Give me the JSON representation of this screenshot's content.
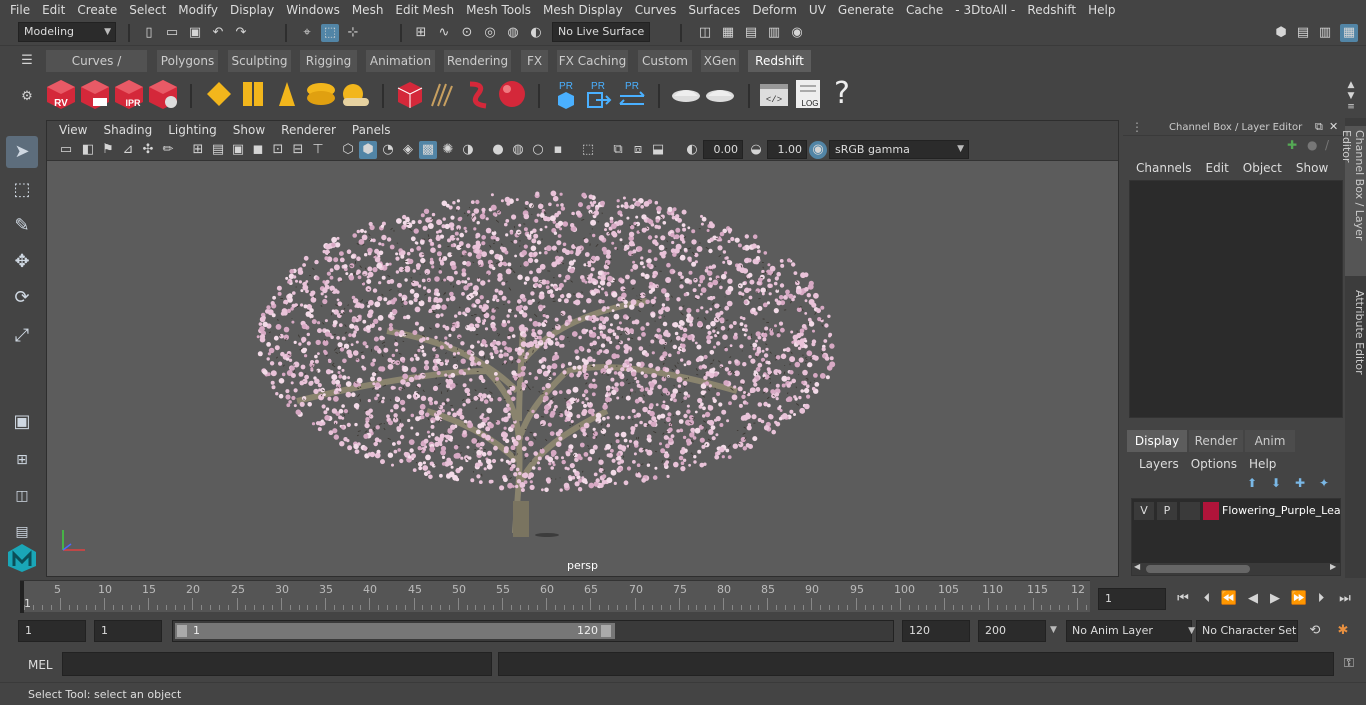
{
  "menubar": {
    "items": [
      "File",
      "Edit",
      "Create",
      "Select",
      "Modify",
      "Display",
      "Windows",
      "Mesh",
      "Edit Mesh",
      "Mesh Tools",
      "Mesh Display",
      "Curves",
      "Surfaces",
      "Deform",
      "UV",
      "Generate",
      "Cache",
      "- 3DtoAll -",
      "Redshift",
      "Help"
    ]
  },
  "status": {
    "mode_select": "Modeling",
    "live_surface": "No Live Surface"
  },
  "shelf": {
    "tabs": [
      "Curves / Surfaces",
      "Polygons",
      "Sculpting",
      "Rigging",
      "Animation",
      "Rendering",
      "FX",
      "FX Caching",
      "Custom",
      "XGen",
      "Redshift"
    ],
    "selected_tab": "Redshift",
    "buttons": [
      {
        "name": "rv",
        "label": "RV"
      },
      {
        "name": "render-clapper",
        "label": ""
      },
      {
        "name": "ipr",
        "label": "IPR"
      },
      {
        "name": "render-settings",
        "label": ""
      }
    ],
    "pr_labels": [
      "PR",
      "PR",
      "PR"
    ],
    "log_label": "LOG",
    "help_label": "?"
  },
  "viewport": {
    "menus": [
      "View",
      "Shading",
      "Lighting",
      "Show",
      "Renderer",
      "Panels"
    ],
    "exposure": "0.00",
    "gamma": "1.00",
    "color_space": "sRGB gamma",
    "panel_label": "persp"
  },
  "channel_box": {
    "title": "Channel Box / Layer Editor",
    "menus": [
      "Channels",
      "Edit",
      "Object",
      "Show"
    ]
  },
  "layer_editor": {
    "tabs": [
      "Display",
      "Render",
      "Anim"
    ],
    "selected_tab": "Display",
    "menus": [
      "Layers",
      "Options",
      "Help"
    ],
    "layers": [
      {
        "v": "V",
        "p": "P",
        "color": "#b0143a",
        "name": "Flowering_Purple_Leaf"
      }
    ]
  },
  "side_tabs": [
    "Channel Box / Layer Editor",
    "Attribute Editor"
  ],
  "timeline": {
    "ticks": [
      "5",
      "10",
      "15",
      "20",
      "25",
      "30",
      "35",
      "40",
      "45",
      "50",
      "55",
      "60",
      "65",
      "70",
      "75",
      "80",
      "85",
      "90",
      "95",
      "100",
      "105",
      "110",
      "115",
      "12"
    ],
    "start_marker": "1",
    "current_frame": "1"
  },
  "range": {
    "start": "1",
    "playback_start": "1",
    "slider_start": "1",
    "slider_end": "120",
    "playback_end": "120",
    "end": "200",
    "anim_layer": "No Anim Layer",
    "character_set": "No Character Set"
  },
  "command": {
    "label": "MEL"
  },
  "statusbar": {
    "message": "Select Tool: select an object"
  },
  "colors": {
    "ui_bg": "#444444",
    "viewport_bg": "#5c5c5c",
    "accent": "#5285a6",
    "redshift_red": "#d4283a",
    "blossom": "#e9c3d9"
  }
}
